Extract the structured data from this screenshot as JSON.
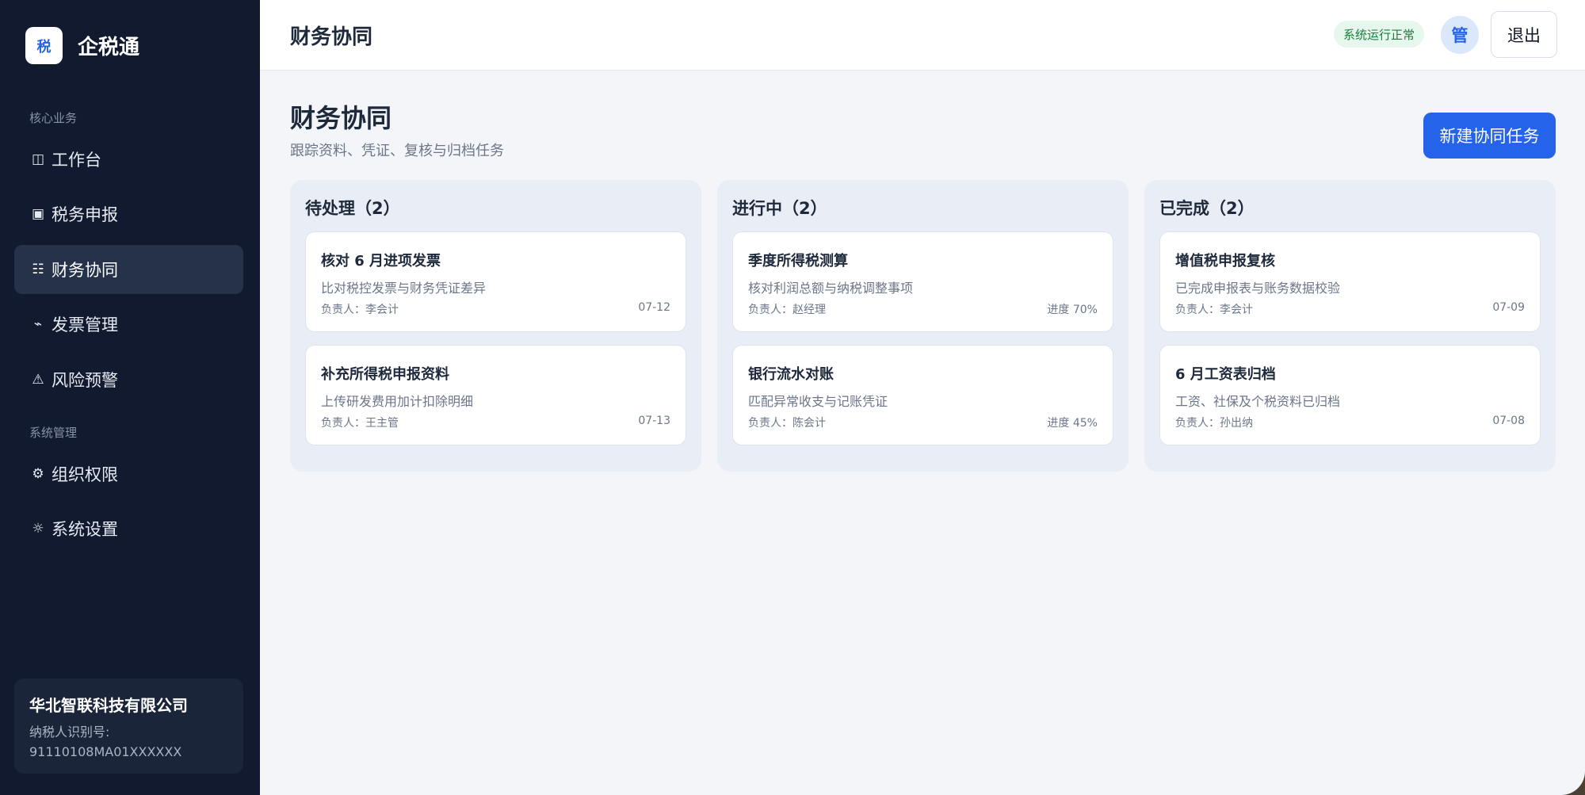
{
  "app": {
    "logo_char": "税",
    "name": "企税通"
  },
  "sidebar": {
    "group_core": "核心业务",
    "group_system": "系统管理",
    "items": [
      {
        "icon": "◫",
        "label": "工作台"
      },
      {
        "icon": "▣",
        "label": "税务申报"
      },
      {
        "icon": "☷",
        "label": "财务协同"
      },
      {
        "icon": "⌁",
        "label": "发票管理"
      },
      {
        "icon": "⚠",
        "label": "风险预警"
      },
      {
        "icon": "⚙",
        "label": "组织权限"
      },
      {
        "icon": "☼",
        "label": "系统设置"
      }
    ],
    "active_item": "财务协同"
  },
  "company": {
    "name": "华北智联科技有限公司",
    "tax_label": "纳税人识别号:",
    "tax_id": "91110108MA01XXXXXX"
  },
  "topbar": {
    "title": "财务协同",
    "status": "系统运行正常",
    "avatar": "管",
    "logout": "退出"
  },
  "page": {
    "title": "财务协同",
    "subtitle": "跟踪资料、凭证、复核与归档任务",
    "new_task_button": "新建协同任务"
  },
  "columns": [
    {
      "title": "待处理（2）",
      "cards": [
        {
          "title": "核对 6 月进项发票",
          "desc": "比对税控发票与财务凭证差异",
          "owner": "负责人：李会计",
          "meta": "07-12"
        },
        {
          "title": "补充所得税申报资料",
          "desc": "上传研发费用加计扣除明细",
          "owner": "负责人：王主管",
          "meta": "07-13"
        }
      ]
    },
    {
      "title": "进行中（2）",
      "cards": [
        {
          "title": "季度所得税测算",
          "desc": "核对利润总额与纳税调整事项",
          "owner": "负责人：赵经理",
          "meta": "进度 70%"
        },
        {
          "title": "银行流水对账",
          "desc": "匹配异常收支与记账凭证",
          "owner": "负责人：陈会计",
          "meta": "进度 45%"
        }
      ]
    },
    {
      "title": "已完成（2）",
      "cards": [
        {
          "title": "增值税申报复核",
          "desc": "已完成申报表与账务数据校验",
          "owner": "负责人：李会计",
          "meta": "07-09"
        },
        {
          "title": "6 月工资表归档",
          "desc": "工资、社保及个税资料已归档",
          "owner": "负责人：孙出纳",
          "meta": "07-08"
        }
      ]
    }
  ],
  "colors": {
    "sidebar_bg": "#111a2e",
    "accent": "#2563eb",
    "status_green": "#15803d",
    "page_bg": "#f3f5f9"
  }
}
